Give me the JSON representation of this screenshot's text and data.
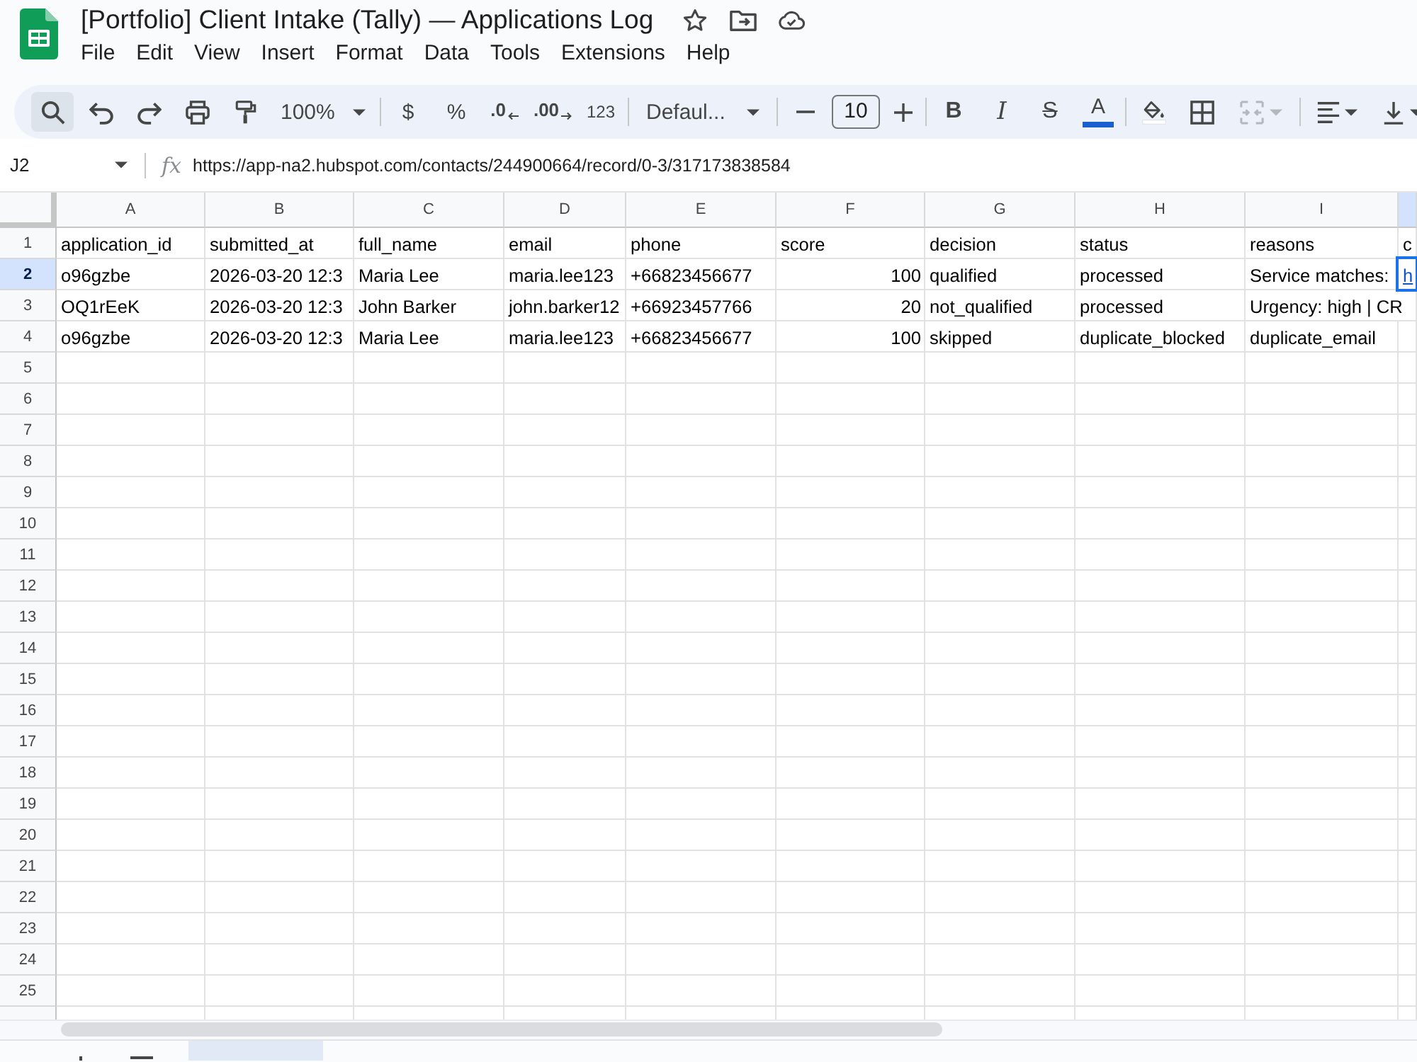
{
  "document": {
    "title": "[Portfolio] Client Intake (Tally) — Applications Log"
  },
  "menu": [
    "File",
    "Edit",
    "View",
    "Insert",
    "Format",
    "Data",
    "Tools",
    "Extensions",
    "Help"
  ],
  "toolbar": {
    "search_highlighted": true,
    "zoom": "100%",
    "currency": "$",
    "percent": "%",
    "decrease_decimals": ".0",
    "increase_decimals": ".00",
    "number_format": "123",
    "font": "Defaul...",
    "font_size": "10",
    "bold": "B",
    "italic": "I",
    "strikethrough": "S",
    "text_color": "A",
    "merge_disabled": true
  },
  "formula_bar": {
    "name_box": "J2",
    "function_label": "fx",
    "formula": "https://app-na2.hubspot.com/contacts/244900664/record/0-3/317173838584"
  },
  "columns": [
    {
      "letter": "A",
      "selected": false
    },
    {
      "letter": "B",
      "selected": false
    },
    {
      "letter": "C",
      "selected": false
    },
    {
      "letter": "D",
      "selected": false
    },
    {
      "letter": "E",
      "selected": false
    },
    {
      "letter": "F",
      "selected": false
    },
    {
      "letter": "G",
      "selected": false
    },
    {
      "letter": "H",
      "selected": false
    },
    {
      "letter": "I",
      "selected": false
    },
    {
      "selected": true
    }
  ],
  "rows": [
    {
      "number": "1",
      "selected": false,
      "cells": [
        {
          "kind": "text",
          "text": "application_id"
        },
        {
          "kind": "text",
          "text": "submitted_at"
        },
        {
          "kind": "text",
          "text": "full_name"
        },
        {
          "kind": "text",
          "text": "email"
        },
        {
          "kind": "text",
          "text": "phone"
        },
        {
          "kind": "text",
          "text": "score"
        },
        {
          "kind": "text",
          "text": "decision"
        },
        {
          "kind": "text",
          "text": "status"
        },
        {
          "kind": "text",
          "text": "reasons"
        },
        {
          "kind": "text",
          "text": "c"
        }
      ]
    },
    {
      "number": "2",
      "selected": true,
      "cells": [
        {
          "kind": "text",
          "text": "o96gzbe"
        },
        {
          "kind": "text",
          "text": "2026-03-20 12:3"
        },
        {
          "kind": "text",
          "text": "Maria Lee"
        },
        {
          "kind": "text",
          "text": "maria.lee123"
        },
        {
          "kind": "text",
          "text": "+66823456677"
        },
        {
          "kind": "number",
          "text": "100"
        },
        {
          "kind": "text",
          "text": "qualified"
        },
        {
          "kind": "text",
          "text": "processed"
        },
        {
          "kind": "text",
          "text": "Service matches:"
        },
        {
          "kind": "link",
          "text": "h"
        }
      ]
    },
    {
      "number": "3",
      "selected": false,
      "cells": [
        {
          "kind": "text",
          "text": "OQ1rEeK"
        },
        {
          "kind": "text",
          "text": "2026-03-20 12:3"
        },
        {
          "kind": "text",
          "text": "John Barker"
        },
        {
          "kind": "text",
          "text": "john.barker12"
        },
        {
          "kind": "text",
          "text": "+66923457766"
        },
        {
          "kind": "number",
          "text": "20"
        },
        {
          "kind": "text",
          "text": "not_qualified"
        },
        {
          "kind": "text",
          "text": "processed"
        },
        {
          "kind": "text",
          "text": "Urgency: high | CR"
        }
      ]
    },
    {
      "number": "4",
      "selected": false,
      "cells": [
        {
          "kind": "text",
          "text": "o96gzbe"
        },
        {
          "kind": "text",
          "text": "2026-03-20 12:3"
        },
        {
          "kind": "text",
          "text": "Maria Lee"
        },
        {
          "kind": "text",
          "text": "maria.lee123"
        },
        {
          "kind": "text",
          "text": "+66823456677"
        },
        {
          "kind": "number",
          "text": "100"
        },
        {
          "kind": "text",
          "text": "skipped"
        },
        {
          "kind": "text",
          "text": "duplicate_blocked"
        },
        {
          "kind": "text",
          "text": "duplicate_email"
        }
      ]
    },
    {
      "number": "5",
      "selected": false
    },
    {
      "number": "6",
      "selected": false
    },
    {
      "number": "7",
      "selected": false
    },
    {
      "number": "8",
      "selected": false
    },
    {
      "number": "9",
      "selected": false
    },
    {
      "number": "10",
      "selected": false
    },
    {
      "number": "11",
      "selected": false
    },
    {
      "number": "12",
      "selected": false
    },
    {
      "number": "13",
      "selected": false
    },
    {
      "number": "14",
      "selected": false
    },
    {
      "number": "15",
      "selected": false
    },
    {
      "number": "16",
      "selected": false
    },
    {
      "number": "17",
      "selected": false
    },
    {
      "number": "18",
      "selected": false
    },
    {
      "number": "19",
      "selected": false
    },
    {
      "number": "20",
      "selected": false
    },
    {
      "number": "21",
      "selected": false
    },
    {
      "number": "22",
      "selected": false
    },
    {
      "number": "23",
      "selected": false
    },
    {
      "number": "24",
      "selected": false
    },
    {
      "number": "25",
      "selected": false
    }
  ],
  "sheet_tabs": [
    {
      "selected": true
    }
  ]
}
